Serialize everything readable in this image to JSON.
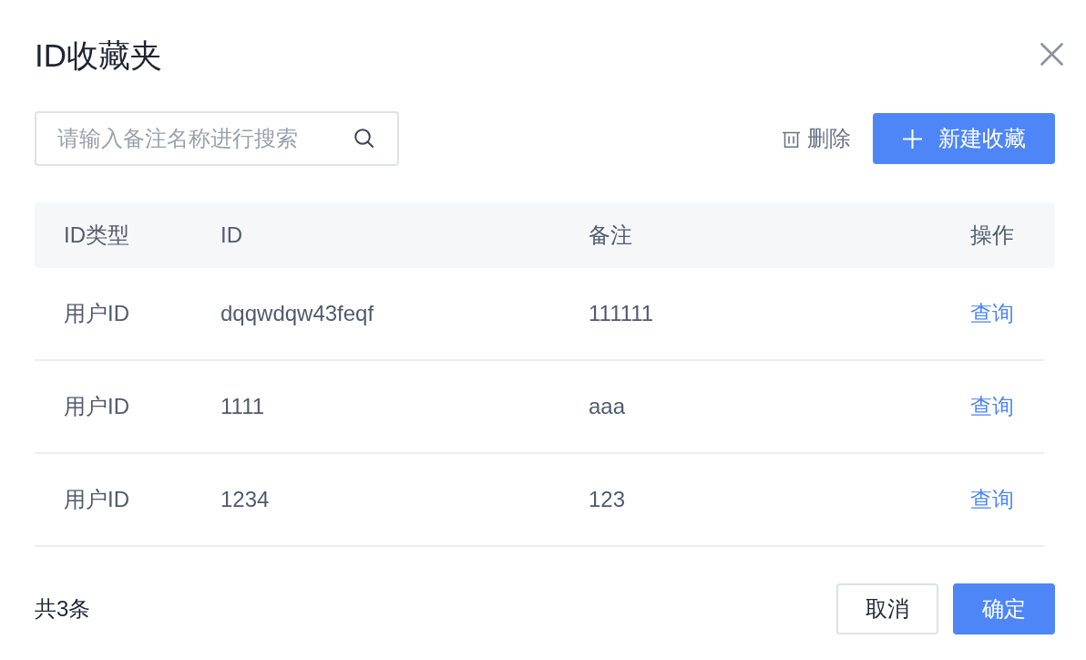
{
  "dialog": {
    "title": "ID收藏夹"
  },
  "toolbar": {
    "search": {
      "placeholder": "请输入备注名称进行搜索"
    },
    "delete_label": "删除",
    "new_button": "新建收藏"
  },
  "table": {
    "columns": [
      "ID类型",
      "ID",
      "备注",
      "操作"
    ],
    "rows": [
      {
        "id_type": "用户ID",
        "id": "dqqwdqw43feqf",
        "note": "111111",
        "action": "查询"
      },
      {
        "id_type": "用户ID",
        "id": "1111",
        "note": "aaa",
        "action": "查询"
      },
      {
        "id_type": "用户ID",
        "id": "1234",
        "note": "123",
        "action": "查询"
      }
    ]
  },
  "footer": {
    "total": "共3条",
    "buttons": [
      {
        "label": "取消",
        "kind": "secondary"
      },
      {
        "label": "确定",
        "kind": "primary"
      }
    ]
  }
}
